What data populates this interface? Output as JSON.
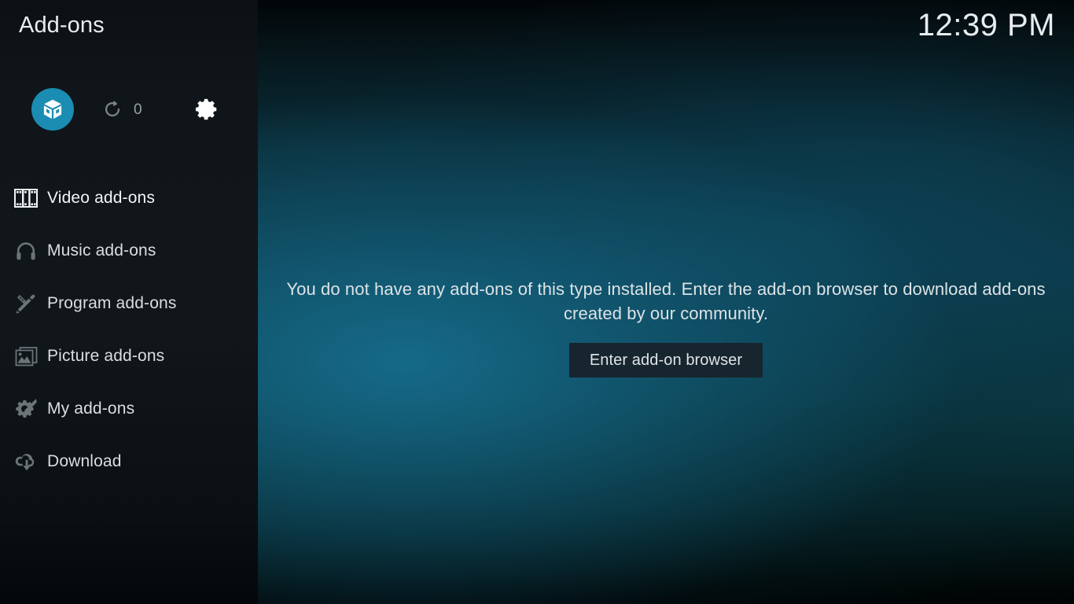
{
  "sidebar": {
    "title": "Add-ons",
    "category_buttons": [
      {
        "name": "installed-addons-button",
        "icon": "package-box-icon",
        "active": true
      },
      {
        "name": "available-updates-button",
        "icon": "refresh-icon",
        "count": "0"
      },
      {
        "name": "addon-settings-button",
        "icon": "gear-icon"
      }
    ],
    "items": [
      {
        "label": "Video add-ons",
        "icon": "film-strip-icon",
        "focused": true
      },
      {
        "label": "Music add-ons",
        "icon": "headphones-icon",
        "focused": false
      },
      {
        "label": "Program add-ons",
        "icon": "pencil-ruler-icon",
        "focused": false
      },
      {
        "label": "Picture add-ons",
        "icon": "image-icon",
        "focused": false
      },
      {
        "label": "My add-ons",
        "icon": "gear-wrench-icon",
        "focused": false
      },
      {
        "label": "Download",
        "icon": "cloud-download-icon",
        "focused": false
      }
    ]
  },
  "header": {
    "clock": "12:39 PM"
  },
  "main": {
    "empty_message": "You do not have any add-ons of this type installed. Enter the add-on browser to download add-ons created by our community.",
    "enter_browser_label": "Enter add-on browser"
  },
  "colors": {
    "accent": "#1b8cb2",
    "sidebar_bg": "#0f1519",
    "main_bg": "#0d3b4a",
    "button_bg": "#17252e",
    "text": "#dde3e6",
    "icon_dim": "#6c7478",
    "icon_bright": "#f2f5f6"
  }
}
